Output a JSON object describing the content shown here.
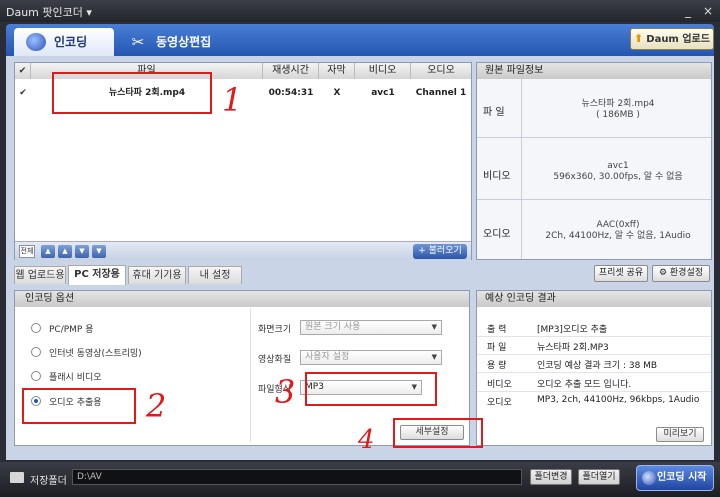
{
  "window": {
    "title": "Daum 팟인코더 ▾",
    "minimize": "_",
    "close": "×"
  },
  "header": {
    "tabs": [
      {
        "label": "인코딩"
      },
      {
        "label": "동영상편집"
      }
    ],
    "upload_button": "Daum 업로드"
  },
  "file_table": {
    "columns": [
      "파일",
      "재생시간",
      "자막",
      "비디오",
      "오디오"
    ],
    "rows": [
      {
        "file": "뉴스타파 2회.mp4",
        "duration": "00:54:31",
        "subtitle": "X",
        "video": "avc1",
        "audio": "Channel 1"
      }
    ],
    "footer": {
      "select_all": "전체",
      "up": "▲",
      "up2": "▲",
      "down": "▼",
      "down2": "▼",
      "import": "+ 불러오기"
    }
  },
  "original_info": {
    "title": "원본 파일정보",
    "rows": [
      {
        "label": "파 일",
        "line1": "뉴스타파 2회.mp4",
        "line2": "( 186MB )"
      },
      {
        "label": "비디오",
        "line1": "avc1",
        "line2": "596x360, 30.00fps, 알 수 없음"
      },
      {
        "label": "오디오",
        "line1": "AAC(0xff)",
        "line2": "2Ch, 44100Hz, 알 수 없음, 1Audio"
      }
    ]
  },
  "sub_tabs": [
    "웹 업로드용",
    "PC 저장용",
    "휴대 기기용",
    "내 설정"
  ],
  "right_buttons": {
    "preset_share": "프리셋 공유",
    "settings": "환경설정"
  },
  "encoding_options": {
    "title": "인코딩 옵션",
    "radios": [
      {
        "label": "PC/PMP 용",
        "selected": false
      },
      {
        "label": "인터넷 동영상(스트리밍)",
        "selected": false
      },
      {
        "label": "플래시 비디오",
        "selected": false
      },
      {
        "label": "오디오 추출용",
        "selected": true
      }
    ],
    "fields": [
      {
        "label": "화면크기",
        "value": "원본 크기 사용"
      },
      {
        "label": "영상화질",
        "value": "사용자 설정"
      },
      {
        "label": "파일형식",
        "value": "MP3"
      }
    ],
    "detail_button": "세부설정"
  },
  "expected_result": {
    "title": "예상 인코딩 결과",
    "rows": [
      {
        "label": "출 력",
        "value": "[MP3]오디오 추출"
      },
      {
        "label": "파 일",
        "value": "뉴스타파 2회.MP3"
      },
      {
        "label": "용 량",
        "value": "인코딩 예상 결과 크기 : 38 MB"
      },
      {
        "label": "비디오",
        "value": "오디오 추출 모드 입니다."
      },
      {
        "label": "오디오",
        "value": "MP3, 2ch, 44100Hz, 96kbps, 1Audio"
      }
    ],
    "preview_button": "미리보기"
  },
  "bottom": {
    "save_label": "저장폴더",
    "save_path": "D:\\AV",
    "change_folder": "폴더변경",
    "open_folder": "폴더열기",
    "start_button": "인코딩 시작"
  },
  "annotations": [
    "1",
    "2",
    "3",
    "4"
  ]
}
